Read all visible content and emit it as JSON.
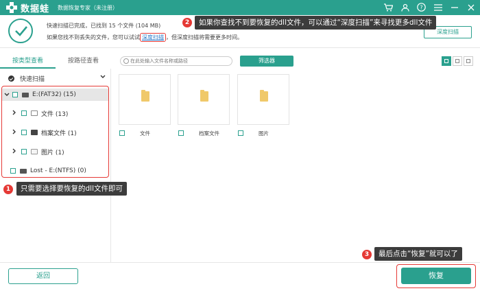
{
  "titlebar": {
    "app_name": "数据蛙",
    "subtitle": "数据恢复专家（未注册）"
  },
  "status": {
    "line1": "快速扫描已完成，已找到 15 个文件 (104 MB)",
    "line2_prefix": "如果您找不到丢失的文件，您可以试试",
    "line2_link": "深度扫描",
    "line2_suffix": "，但深度扫描将需要更多时间。",
    "deep_scan_button": "深度扫描"
  },
  "annotations": {
    "tip1": "只需要选择要恢复的dll文件即可",
    "tip2": "如果你查找不到要恢复的dll文件，可以通过“深度扫描”来寻找更多dll文件",
    "tip3": "最后点击“恢复”就可以了",
    "badge1": "1",
    "badge2": "2",
    "badge3": "3"
  },
  "tabs": [
    "按类型查看",
    "按路径查看"
  ],
  "left": {
    "quick_scan": "快速扫描",
    "tree": [
      {
        "label": "E:(FAT32) (15)"
      },
      {
        "label": "文件 (13)"
      },
      {
        "label": "档案文件 (1)"
      },
      {
        "label": "图片 (1)"
      },
      {
        "label": "Lost - E:(NTFS) (0)"
      }
    ]
  },
  "main": {
    "search_placeholder": "在此处输入文件名称或路径",
    "filter_button": "筛选器",
    "files": [
      {
        "name": "文件"
      },
      {
        "name": "档案文件"
      },
      {
        "name": "图片"
      }
    ]
  },
  "bottom": {
    "back_button": "返回",
    "recover_button": "恢复"
  },
  "colors": {
    "accent": "#2aa08e",
    "highlight": "#e53935"
  }
}
